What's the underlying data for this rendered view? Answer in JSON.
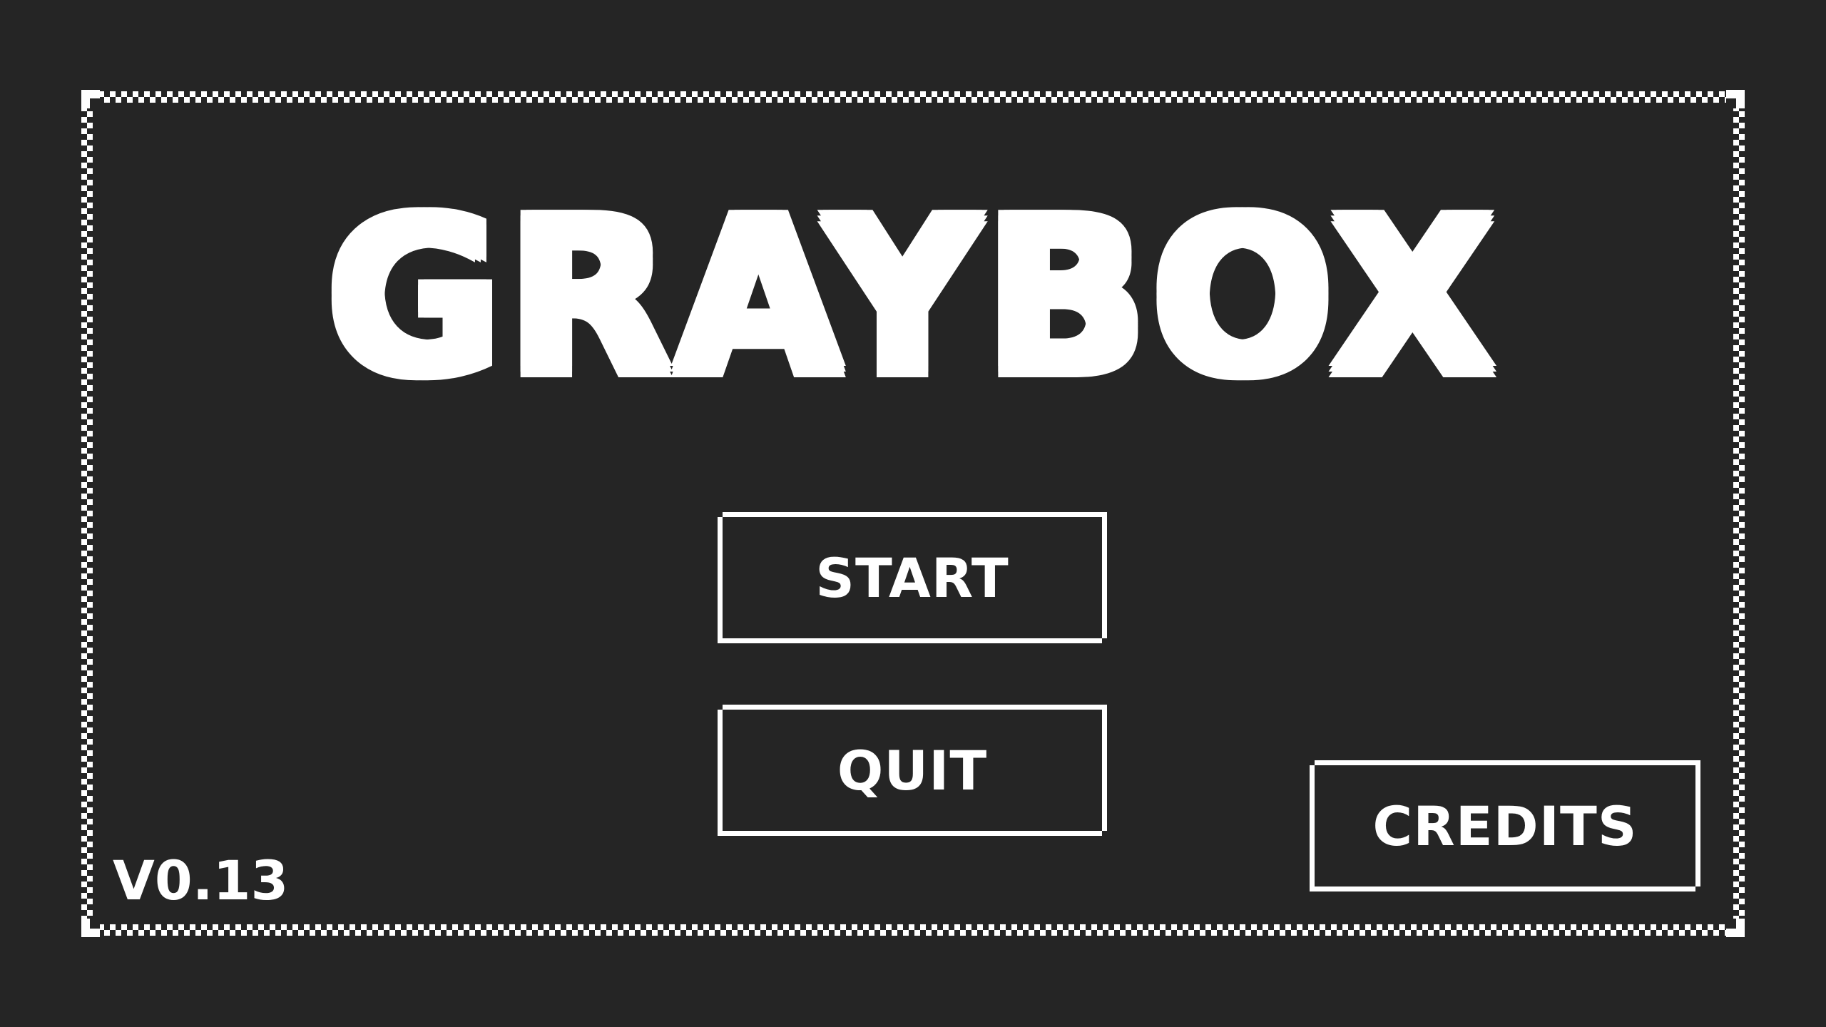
{
  "game": {
    "title": "GRAYBOX",
    "version": "V0.13"
  },
  "menu": {
    "start_label": "START",
    "quit_label": "QUIT",
    "credits_label": "CREDITS"
  },
  "colors": {
    "background": "#252525",
    "foreground": "#ffffff"
  }
}
